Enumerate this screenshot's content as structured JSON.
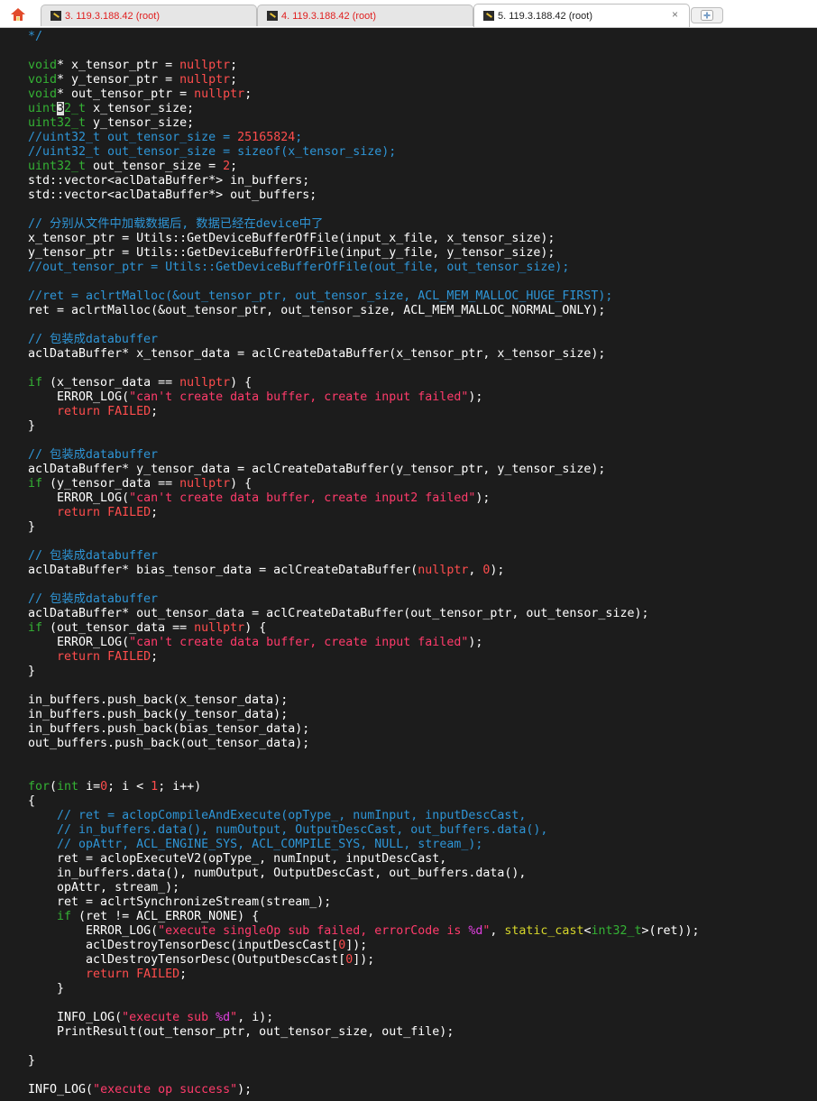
{
  "tabs": [
    {
      "label": "3. 119.3.188.42 (root)",
      "active": false
    },
    {
      "label": "4. 119.3.188.42 (root)",
      "active": false
    },
    {
      "label": "5. 119.3.188.42 (root)",
      "active": true
    }
  ],
  "close_glyph": "×",
  "colors": {
    "background": "#1c1c1c",
    "keyword": "#34b234",
    "comment": "#2e95d6",
    "string": "#ff3b6b",
    "number": "#ff4d4d",
    "tab_inactive_text": "#e01e1e"
  },
  "code_lines": [
    [
      [
        "c",
        "*/"
      ]
    ],
    [],
    [
      [
        "k",
        "void"
      ],
      [
        "x",
        "* x_tensor_ptr = "
      ],
      [
        "n",
        "nullptr"
      ],
      [
        "x",
        ";"
      ]
    ],
    [
      [
        "k",
        "void"
      ],
      [
        "x",
        "* y_tensor_ptr = "
      ],
      [
        "n",
        "nullptr"
      ],
      [
        "x",
        ";"
      ]
    ],
    [
      [
        "k",
        "void"
      ],
      [
        "x",
        "* out_tensor_ptr = "
      ],
      [
        "n",
        "nullptr"
      ],
      [
        "x",
        ";"
      ]
    ],
    [
      [
        "k",
        "uint"
      ],
      [
        "cur",
        "3"
      ],
      [
        "k",
        "2_t"
      ],
      [
        "x",
        " x_tensor_size;"
      ]
    ],
    [
      [
        "k",
        "uint32_t"
      ],
      [
        "x",
        " y_tensor_size;"
      ]
    ],
    [
      [
        "c",
        "//uint32_t out_tensor_size = "
      ],
      [
        "n",
        "25165824"
      ],
      [
        "c",
        ";"
      ]
    ],
    [
      [
        "c",
        "//uint32_t out_tensor_size = sizeof(x_tensor_size);"
      ]
    ],
    [
      [
        "k",
        "uint32_t"
      ],
      [
        "x",
        " out_tensor_size = "
      ],
      [
        "n",
        "2"
      ],
      [
        "x",
        ";"
      ]
    ],
    [
      [
        "x",
        "std::vector<aclDataBuffer*> in_buffers;"
      ]
    ],
    [
      [
        "x",
        "std::vector<aclDataBuffer*> out_buffers;"
      ]
    ],
    [],
    [
      [
        "c",
        "// 分别从文件中加载数据后, 数据已经在device中了"
      ]
    ],
    [
      [
        "x",
        "x_tensor_ptr = Utils::GetDeviceBufferOfFile(input_x_file, x_tensor_size);"
      ]
    ],
    [
      [
        "x",
        "y_tensor_ptr = Utils::GetDeviceBufferOfFile(input_y_file, y_tensor_size);"
      ]
    ],
    [
      [
        "c",
        "//out_tensor_ptr = Utils::GetDeviceBufferOfFile(out_file, out_tensor_size);"
      ]
    ],
    [],
    [
      [
        "c",
        "//ret = aclrtMalloc(&out_tensor_ptr, out_tensor_size, ACL_MEM_MALLOC_HUGE_FIRST);"
      ]
    ],
    [
      [
        "x",
        "ret = aclrtMalloc(&out_tensor_ptr, out_tensor_size, ACL_MEM_MALLOC_NORMAL_ONLY);"
      ]
    ],
    [],
    [
      [
        "c",
        "// 包装成databuffer"
      ]
    ],
    [
      [
        "x",
        "aclDataBuffer* x_tensor_data = aclCreateDataBuffer(x_tensor_ptr, x_tensor_size);"
      ]
    ],
    [],
    [
      [
        "k",
        "if"
      ],
      [
        "x",
        " (x_tensor_data == "
      ],
      [
        "n",
        "nullptr"
      ],
      [
        "x",
        ") {"
      ]
    ],
    [
      [
        "x",
        "    ERROR_LOG("
      ],
      [
        "s",
        "\"can't create data buffer, create input failed\""
      ],
      [
        "x",
        ");"
      ]
    ],
    [
      [
        "x",
        "    "
      ],
      [
        "n",
        "return"
      ],
      [
        "x",
        " "
      ],
      [
        "n",
        "FAILED"
      ],
      [
        "x",
        ";"
      ]
    ],
    [
      [
        "x",
        "}"
      ]
    ],
    [],
    [
      [
        "c",
        "// 包装成databuffer"
      ]
    ],
    [
      [
        "x",
        "aclDataBuffer* y_tensor_data = aclCreateDataBuffer(y_tensor_ptr, y_tensor_size);"
      ]
    ],
    [
      [
        "k",
        "if"
      ],
      [
        "x",
        " (y_tensor_data == "
      ],
      [
        "n",
        "nullptr"
      ],
      [
        "x",
        ") {"
      ]
    ],
    [
      [
        "x",
        "    ERROR_LOG("
      ],
      [
        "s",
        "\"can't create data buffer, create input2 failed\""
      ],
      [
        "x",
        ");"
      ]
    ],
    [
      [
        "x",
        "    "
      ],
      [
        "n",
        "return"
      ],
      [
        "x",
        " "
      ],
      [
        "n",
        "FAILED"
      ],
      [
        "x",
        ";"
      ]
    ],
    [
      [
        "x",
        "}"
      ]
    ],
    [],
    [
      [
        "c",
        "// 包装成databuffer"
      ]
    ],
    [
      [
        "x",
        "aclDataBuffer* bias_tensor_data = aclCreateDataBuffer("
      ],
      [
        "n",
        "nullptr"
      ],
      [
        "x",
        ", "
      ],
      [
        "n",
        "0"
      ],
      [
        "x",
        ");"
      ]
    ],
    [],
    [
      [
        "c",
        "// 包装成databuffer"
      ]
    ],
    [
      [
        "x",
        "aclDataBuffer* out_tensor_data = aclCreateDataBuffer(out_tensor_ptr, out_tensor_size);"
      ]
    ],
    [
      [
        "k",
        "if"
      ],
      [
        "x",
        " (out_tensor_data == "
      ],
      [
        "n",
        "nullptr"
      ],
      [
        "x",
        ") {"
      ]
    ],
    [
      [
        "x",
        "    ERROR_LOG("
      ],
      [
        "s",
        "\"can't create data buffer, create input failed\""
      ],
      [
        "x",
        ");"
      ]
    ],
    [
      [
        "x",
        "    "
      ],
      [
        "n",
        "return"
      ],
      [
        "x",
        " "
      ],
      [
        "n",
        "FAILED"
      ],
      [
        "x",
        ";"
      ]
    ],
    [
      [
        "x",
        "}"
      ]
    ],
    [],
    [
      [
        "x",
        "in_buffers.push_back(x_tensor_data);"
      ]
    ],
    [
      [
        "x",
        "in_buffers.push_back(y_tensor_data);"
      ]
    ],
    [
      [
        "x",
        "in_buffers.push_back(bias_tensor_data);"
      ]
    ],
    [
      [
        "x",
        "out_buffers.push_back(out_tensor_data);"
      ]
    ],
    [],
    [],
    [
      [
        "k",
        "for"
      ],
      [
        "x",
        "("
      ],
      [
        "k",
        "int"
      ],
      [
        "x",
        " i="
      ],
      [
        "n",
        "0"
      ],
      [
        "x",
        "; i < "
      ],
      [
        "n",
        "1"
      ],
      [
        "x",
        "; i++)"
      ]
    ],
    [
      [
        "x",
        "{"
      ]
    ],
    [
      [
        "x",
        "    "
      ],
      [
        "c",
        "// ret = aclopCompileAndExecute(opType_, numInput, inputDescCast,"
      ]
    ],
    [
      [
        "x",
        "    "
      ],
      [
        "c",
        "// in_buffers.data(), numOutput, OutputDescCast, out_buffers.data(),"
      ]
    ],
    [
      [
        "x",
        "    "
      ],
      [
        "c",
        "// opAttr, ACL_ENGINE_SYS, ACL_COMPILE_SYS, NULL, stream_);"
      ]
    ],
    [
      [
        "x",
        "    ret = aclopExecuteV2(opType_, numInput, inputDescCast,"
      ]
    ],
    [
      [
        "x",
        "    in_buffers.data(), numOutput, OutputDescCast, out_buffers.data(),"
      ]
    ],
    [
      [
        "x",
        "    opAttr, stream_);"
      ]
    ],
    [
      [
        "x",
        "    ret = aclrtSynchronizeStream(stream_);"
      ]
    ],
    [
      [
        "x",
        "    "
      ],
      [
        "k",
        "if"
      ],
      [
        "x",
        " (ret != ACL_ERROR_NONE) {"
      ]
    ],
    [
      [
        "x",
        "        ERROR_LOG("
      ],
      [
        "s",
        "\"execute singleOp sub failed, errorCode is "
      ],
      [
        "m",
        "%d"
      ],
      [
        "s",
        "\""
      ],
      [
        "x",
        ", "
      ],
      [
        "y",
        "static_cast"
      ],
      [
        "x",
        "<"
      ],
      [
        "k",
        "int32_t"
      ],
      [
        "x",
        ">(ret));"
      ]
    ],
    [
      [
        "x",
        "        aclDestroyTensorDesc(inputDescCast["
      ],
      [
        "n",
        "0"
      ],
      [
        "x",
        "]);"
      ]
    ],
    [
      [
        "x",
        "        aclDestroyTensorDesc(OutputDescCast["
      ],
      [
        "n",
        "0"
      ],
      [
        "x",
        "]);"
      ]
    ],
    [
      [
        "x",
        "        "
      ],
      [
        "n",
        "return"
      ],
      [
        "x",
        " "
      ],
      [
        "n",
        "FAILED"
      ],
      [
        "x",
        ";"
      ]
    ],
    [
      [
        "x",
        "    }"
      ]
    ],
    [],
    [
      [
        "x",
        "    INFO_LOG("
      ],
      [
        "s",
        "\"execute sub "
      ],
      [
        "m",
        "%d"
      ],
      [
        "s",
        "\""
      ],
      [
        "x",
        ", i);"
      ]
    ],
    [
      [
        "x",
        "    PrintResult(out_tensor_ptr, out_tensor_size, out_file);"
      ]
    ],
    [],
    [
      [
        "x",
        "}"
      ]
    ],
    [],
    [
      [
        "x",
        "INFO_LOG("
      ],
      [
        "s",
        "\"execute op success\""
      ],
      [
        "x",
        ");"
      ]
    ]
  ]
}
